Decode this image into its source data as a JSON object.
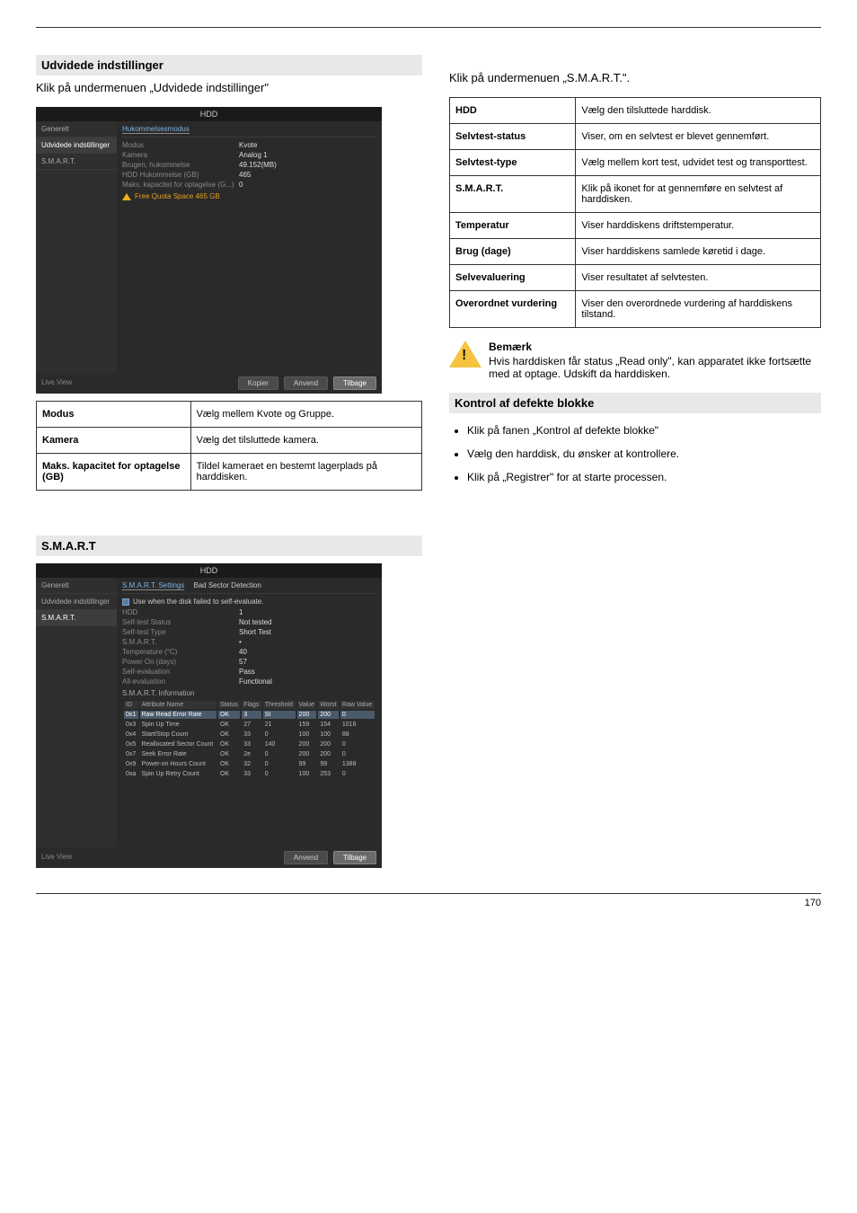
{
  "left": {
    "sectionBar1": "Udvidede indstillinger",
    "intro": "Klik på undermenuen „Udvidede indstillinger\"",
    "app1": {
      "title": "HDD",
      "sidebar": [
        "Generelt",
        "Udvidede indstillinger",
        "S.M.A.R.T."
      ],
      "tab": "Hukommelsesmodus",
      "mode_k": "Modus",
      "mode_v": "Kvote",
      "camera_k": "Kamera",
      "camera_v": "Analog 1",
      "used_k": "Brugen, hukommelse",
      "used_v": "49.152(MB)",
      "hdd_k": "HDD Hukommelse (GB)",
      "hdd_v": "465",
      "max_k": "Maks. kapacitet for optagelse (G...)",
      "max_v": "0",
      "warn": "Free Quota Space 465 GB",
      "btn_back": "Kopier",
      "btn_apply": "Anvend",
      "btn_close": "Tilbage",
      "live": "Live View"
    },
    "params1": [
      [
        "Modus",
        "Vælg mellem Kvote og Gruppe."
      ],
      [
        "Kamera",
        "Vælg det tilsluttede kamera."
      ],
      [
        "Maks. kapacitet for optagelse (GB)",
        "Tildel kameraet en bestemt lagerplads på harddisken."
      ]
    ],
    "sectionBar2": "S.M.A.R.T",
    "app2": {
      "title": "HDD",
      "sidebar": [
        "Generelt",
        "Udvidede indstillinger",
        "S.M.A.R.T."
      ],
      "tabs": [
        "S.M.A.R.T. Settings",
        "Bad Sector Detection"
      ],
      "chk": "Use when the disk failed to self-evaluate.",
      "rows": [
        [
          "HDD",
          "1"
        ],
        [
          "Self-test Status",
          "Not tested"
        ],
        [
          "Self-test Type",
          "Short Test"
        ],
        [
          "S.M.A.R.T.",
          "•"
        ],
        [
          "Temperature (°C)",
          "40"
        ],
        [
          "Power On (days)",
          "57"
        ],
        [
          "Self-evaluation",
          "Pass"
        ],
        [
          "All-evaluation",
          "Functional"
        ]
      ],
      "info_label": "S.M.A.R.T. Information",
      "headers": [
        "ID",
        "Attribute Name",
        "Status",
        "Flags",
        "Threshold",
        "Value",
        "Worst",
        "Raw Value"
      ],
      "data": [
        [
          "0x1",
          "Raw Read Error Rate",
          "OK",
          "3",
          "SI",
          "200",
          "200",
          "0"
        ],
        [
          "0x3",
          "Spin Up Time",
          "OK",
          "27",
          "21",
          "159",
          "154",
          "1016"
        ],
        [
          "0x4",
          "Start/Stop Count",
          "OK",
          "33",
          "0",
          "100",
          "100",
          "88"
        ],
        [
          "0x5",
          "Reallocated Sector Count",
          "OK",
          "33",
          "140",
          "200",
          "200",
          "0"
        ],
        [
          "0x7",
          "Seek Error Rate",
          "OK",
          "2e",
          "0",
          "200",
          "200",
          "0"
        ],
        [
          "0x9",
          "Power-on Hours Count",
          "OK",
          "32",
          "0",
          "99",
          "99",
          "1388"
        ],
        [
          "0xa",
          "Spin Up Retry Count",
          "OK",
          "33",
          "0",
          "100",
          "253",
          "0"
        ]
      ],
      "btn_apply": "Anvend",
      "btn_back": "Tilbage",
      "live": "Live View"
    }
  },
  "right": {
    "intro": "Klik på undermenuen „S.M.A.R.T.\".",
    "params": [
      [
        "HDD",
        "Vælg den tilsluttede harddisk."
      ],
      [
        "Selvtest-status",
        "Viser, om en selvtest er blevet gennemført."
      ],
      [
        "Selvtest-type",
        "Vælg mellem kort test, udvidet test og transporttest."
      ],
      [
        "S.M.A.R.T.",
        "Klik på ikonet for at gennemføre en selvtest af harddisken."
      ],
      [
        "Temperatur",
        "Viser harddiskens driftstemperatur."
      ],
      [
        "Brug (dage)",
        "Viser harddiskens samlede køretid i dage."
      ],
      [
        "Selvevaluering",
        "Viser resultatet af selvtesten."
      ],
      [
        "Overordnet vurdering",
        "Viser den overordnede vurdering af harddiskens tilstand."
      ]
    ],
    "note_h": "Bemærk",
    "note_body": "Hvis harddisken får status „Read only\", kan apparatet ikke fortsætte med at optage. Udskift da harddisken.",
    "checks_h": "Kontrol af defekte blokke",
    "bullets": [
      "Klik på fanen „Kontrol af defekte blokke\"",
      "Vælg den harddisk, du ønsker at kontrollere.",
      "Klik på „Registrer\" for at starte processen."
    ]
  },
  "page": "170"
}
